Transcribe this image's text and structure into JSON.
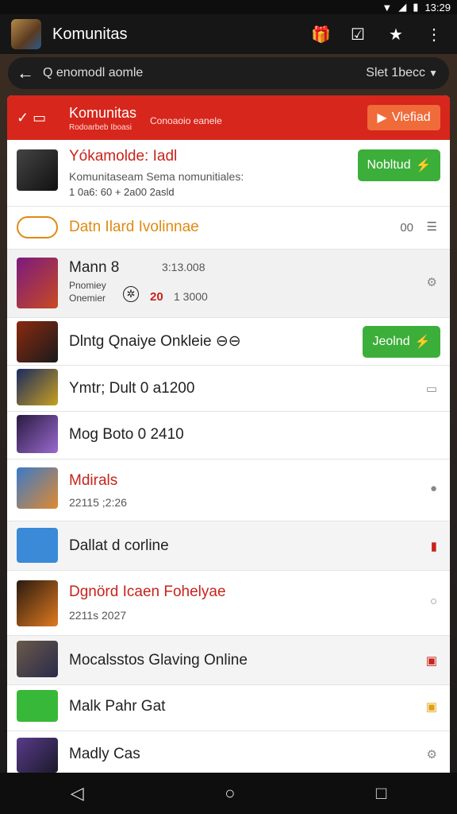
{
  "status": {
    "time": "13:29"
  },
  "appbar": {
    "title": "Komunitas",
    "icons": [
      "gift-icon",
      "check-box-icon",
      "star-icon",
      "more-vert-icon"
    ]
  },
  "search": {
    "text": "Q enomodl aomle",
    "sort_label": "Slet 1becc"
  },
  "header": {
    "title": "Komunitas",
    "subtitle": "Rodoarbeb Iboasi",
    "tagline": "Conoaoio eanele",
    "button_label": "Vlefiad",
    "colors": {
      "bar": "#d7261b",
      "button": "#f06b3a"
    }
  },
  "rows": [
    {
      "title": "Yókamolde: Iadl",
      "line1": "Komunitaseam Sema nomunitiales:",
      "line2": "1 0a6: 60 + 2a00 2asld",
      "button": "Nobltud"
    },
    {
      "title": "Datn Ilard Ivolinnae",
      "count": "00"
    },
    {
      "title": "Mann 8",
      "time": "3:13.008",
      "line1": "Pnomiey",
      "line2": "Onemier",
      "red_num": "20",
      "num": "1 3000"
    },
    {
      "title": "Dlntg Qnaiye Onkleie ⊖⊖",
      "button": "Jeolnd"
    },
    {
      "title": "Ymtr; Dult 0 a1200"
    },
    {
      "title": "Mog Boto 0 2410"
    },
    {
      "title": "Mdirals",
      "line1": "22115 ;2:26"
    },
    {
      "title": "Dallat d corline"
    },
    {
      "title": "Dgnörd Icaen Fohelyae",
      "line1": "2211s 2027"
    },
    {
      "title": "Mocalsstos Glaving Online"
    },
    {
      "title": "Malk Pahr Gat"
    },
    {
      "title": "Madly Cas"
    }
  ],
  "colors": {
    "green": "#3cae3a",
    "red_text": "#c8231b",
    "orange_text": "#e08a12"
  }
}
